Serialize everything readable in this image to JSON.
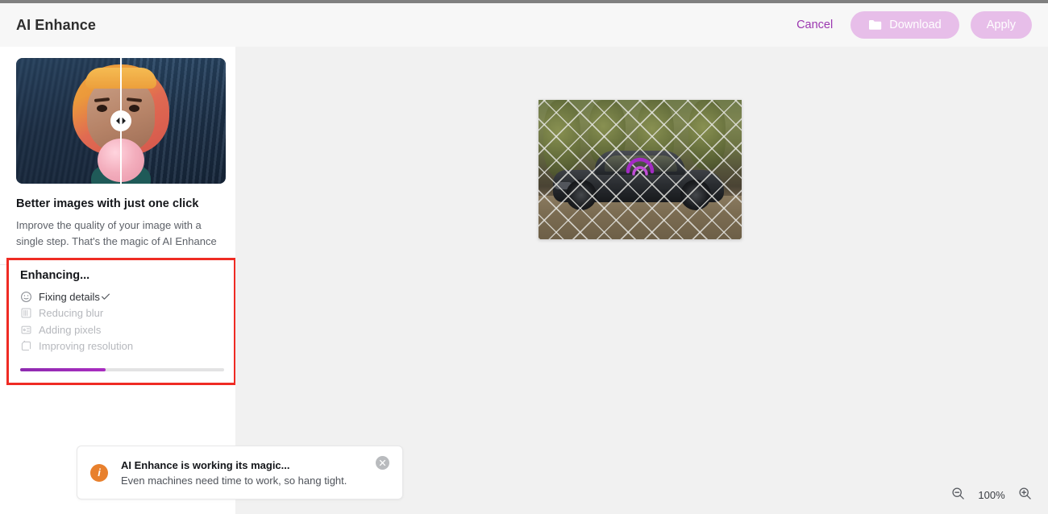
{
  "header": {
    "title": "AI Enhance",
    "cancel_label": "Cancel",
    "download_label": "Download",
    "apply_label": "Apply"
  },
  "sidebar": {
    "promo": {
      "title": "Better images with just one click",
      "description": "Improve the quality of your image with a single step. That's the magic of AI Enhance",
      "comparison_handle_icon": "compare-slider-icon"
    },
    "enhancing": {
      "title": "Enhancing...",
      "steps": [
        {
          "label": "Fixing details",
          "icon": "smiley-face-icon",
          "state": "active",
          "checked": true
        },
        {
          "label": "Reducing blur",
          "icon": "blur-panel-icon",
          "state": "pending",
          "checked": false
        },
        {
          "label": "Adding pixels",
          "icon": "pixels-grid-icon",
          "state": "pending",
          "checked": false
        },
        {
          "label": "Improving resolution",
          "icon": "resolution-corner-icon",
          "state": "pending",
          "checked": false
        }
      ],
      "progress_percent": 42,
      "progress_color": "#9b2bb5",
      "highlight_color": "#ef2b24"
    },
    "collapse_icon": "chevron-left-icon"
  },
  "canvas": {
    "image_alt": "dark sports car behind a chain-link fence",
    "loading_spinner_icon": "spinner-icon",
    "spinner_color": "#a32bc4"
  },
  "toast": {
    "icon": "info-icon",
    "icon_color": "#e8802d",
    "title": "AI Enhance is working its magic...",
    "subtitle": "Even machines need time to work, so hang tight.",
    "close_icon": "close-icon"
  },
  "zoom": {
    "zoom_out_icon": "zoom-out-icon",
    "level": "100%",
    "zoom_in_icon": "zoom-in-icon"
  }
}
